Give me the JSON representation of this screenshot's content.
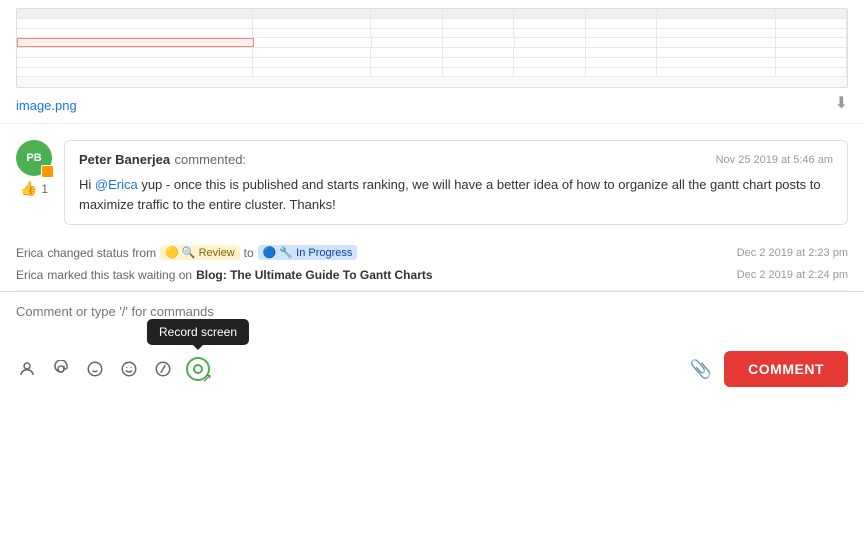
{
  "image": {
    "filename": "image.png",
    "download_label": "⬇"
  },
  "comment": {
    "avatar_initials": "PB",
    "commenter": "Peter Banerjea",
    "action": "commented:",
    "timestamp": "Nov 25 2019 at 5:46 am",
    "like_count": "1",
    "text_before_mention": "Hi ",
    "mention": "@Erica",
    "text_after_mention": " yup - once this is published and starts ranking, we will have a better idea of how to organize all the gantt chart posts to maximize traffic to the entire cluster. Thanks!"
  },
  "activity": [
    {
      "actor": "Erica",
      "action": "changed status from",
      "from_status": "🟡 🔍 Review",
      "connector": "to",
      "to_status": "🔵 🔧 In Progress",
      "timestamp": "Dec 2 2019 at 2:23 pm"
    },
    {
      "actor": "Erica",
      "action": "marked this task waiting on",
      "link": "Blog: The Ultimate Guide To Gantt Charts",
      "timestamp": "Dec 2 2019 at 2:24 pm"
    }
  ],
  "input": {
    "placeholder": "Comment or type '/' for commands"
  },
  "toolbar": {
    "icons": [
      "person-icon",
      "mention-icon",
      "emoji-smile-icon",
      "emoji-icon",
      "slash-icon",
      "record-icon"
    ],
    "record_tooltip": "Record screen",
    "comment_button": "COMMENT"
  }
}
